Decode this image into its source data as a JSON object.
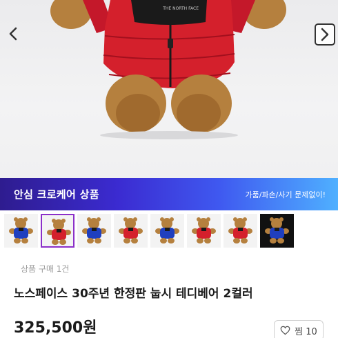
{
  "banner": {
    "title": "안심 크로케어 상품",
    "subtitle": "가품/파손/사기 문제없이!"
  },
  "gallery": {
    "thumbnails": [
      {
        "jacket_color": "#1f3fbf",
        "selected": false
      },
      {
        "jacket_color": "#d4202c",
        "selected": true
      },
      {
        "jacket_color": "#1f3fbf",
        "selected": false
      },
      {
        "jacket_color": "#d4202c",
        "selected": false
      },
      {
        "jacket_color": "#1f3fbf",
        "selected": false
      },
      {
        "jacket_color": "#d4202c",
        "selected": false
      },
      {
        "jacket_color": "#d4202c",
        "selected": false
      },
      {
        "jacket_color": "#1f3fbf",
        "selected": false
      }
    ]
  },
  "product": {
    "purchase_count": "상품 구매 1건",
    "title": "노스페이스 30주년 한정판 눕시 테디베어 2컬러",
    "price": "325,500원"
  },
  "like": {
    "label": "찜 10"
  },
  "colors": {
    "jacket_red": "#d4202c",
    "jacket_blue": "#1f3fbf",
    "bear_fur": "#b5803e",
    "selected_border": "#8b2fc9"
  },
  "icons": {
    "prev": "chevron-left-icon",
    "next": "chevron-right-icon",
    "like": "heart-outline-icon"
  }
}
